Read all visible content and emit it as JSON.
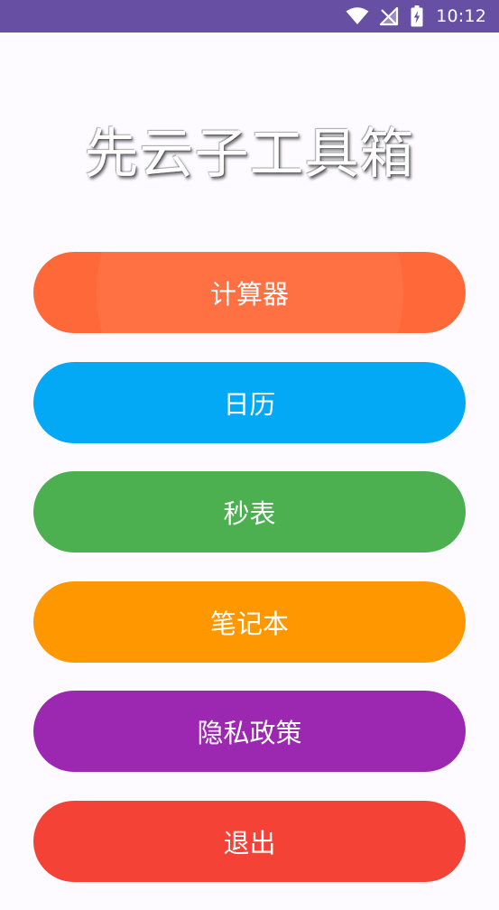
{
  "status_bar": {
    "time": "10:12",
    "background": "#6750a4",
    "icons": [
      "wifi-icon",
      "no-signal-icon",
      "battery-charging-icon"
    ]
  },
  "app": {
    "title": "先云子工具箱"
  },
  "menu": {
    "items": [
      {
        "label": "计算器",
        "color": "#ff6838"
      },
      {
        "label": "日历",
        "color": "#03a9f4"
      },
      {
        "label": "秒表",
        "color": "#4caf50"
      },
      {
        "label": "笔记本",
        "color": "#ff9800"
      },
      {
        "label": "隐私政策",
        "color": "#9c27b0"
      },
      {
        "label": "退出",
        "color": "#f44336"
      }
    ]
  }
}
